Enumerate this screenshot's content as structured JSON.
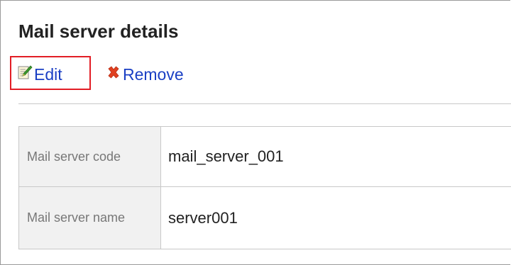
{
  "page": {
    "title": "Mail server details"
  },
  "actions": {
    "edit_label": "Edit",
    "remove_label": "Remove",
    "edit_icon": "edit-note-icon",
    "remove_icon": "red-x-icon",
    "link_color": "#1a3fc4",
    "highlight_color": "#e21d25"
  },
  "details": {
    "rows": [
      {
        "label": "Mail server code",
        "value": "mail_server_001"
      },
      {
        "label": "Mail server name",
        "value": "server001"
      }
    ]
  }
}
